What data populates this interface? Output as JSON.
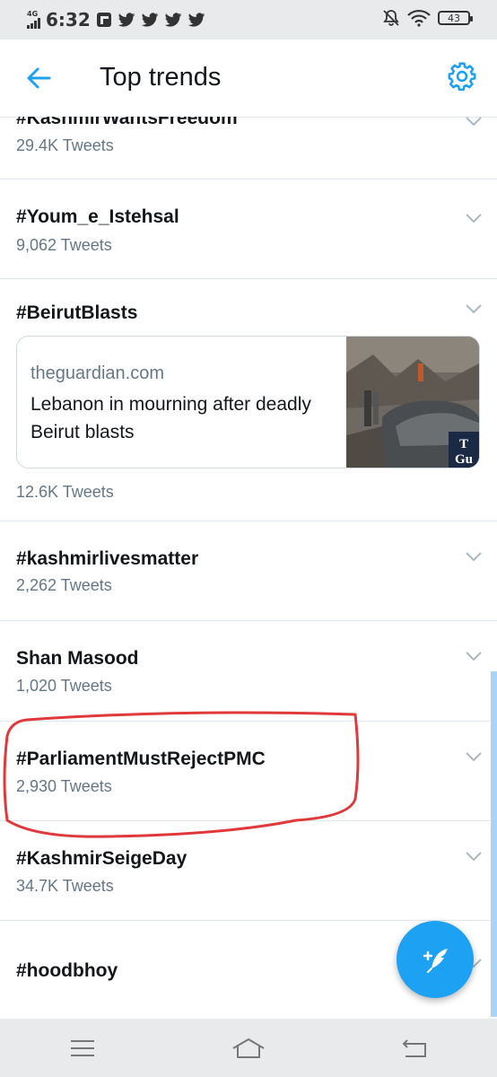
{
  "status_bar": {
    "network": "4G",
    "time": "6:32",
    "battery": "43",
    "notification_icons": [
      "flipboard-icon",
      "twitter-icon",
      "twitter-icon",
      "twitter-icon",
      "twitter-icon"
    ]
  },
  "header": {
    "title": "Top trends",
    "back_icon": "arrow-left-icon",
    "settings_icon": "gear-icon"
  },
  "trends": [
    {
      "name": "#KashmirWantsFreedom",
      "count": "29.4K Tweets"
    },
    {
      "name": "#Youm_e_Istehsal",
      "count": "9,062 Tweets"
    },
    {
      "name": "#BeirutBlasts",
      "count": "12.6K Tweets",
      "card": {
        "source": "theguardian.com",
        "title": "Lebanon in mourning after deadly Beirut blasts",
        "thumb_logo": "The Guardian"
      }
    },
    {
      "name": "#kashmirlivesmatter",
      "count": "2,262 Tweets"
    },
    {
      "name": "Shan Masood",
      "count": "1,020 Tweets"
    },
    {
      "name": "#ParliamentMustRejectPMC",
      "count": "2,930 Tweets"
    },
    {
      "name": "#KashmirSeigeDay",
      "count": "34.7K Tweets"
    },
    {
      "name": "#hoodbhoy",
      "count": ""
    }
  ],
  "fab": {
    "icon": "compose-tweet-icon"
  },
  "nav_bar": {
    "icons": [
      "menu-icon",
      "home-icon",
      "back-icon"
    ]
  },
  "colors": {
    "accent": "#1da1f2",
    "annotation": "#e0393b",
    "secondary_text": "#657786"
  }
}
